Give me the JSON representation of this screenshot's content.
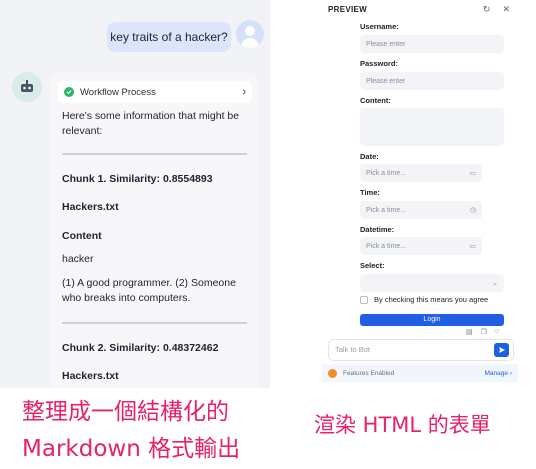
{
  "chat": {
    "user_message": "key traits of a hacker?",
    "workflow_label": "Workflow Process",
    "intro": "Here's some information that might be relevant:",
    "chunk1_title": "Chunk 1. Similarity: 0.8554893",
    "chunk1_file": "Hackers.txt",
    "content_heading": "Content",
    "content_word": "hacker",
    "content_text": "(1) A good programmer. (2) Someone who breaks into computers.",
    "chunk2_title": "Chunk 2. Similarity: 0.48372462",
    "chunk2_file": "Hackers.txt"
  },
  "preview": {
    "title": "PREVIEW",
    "username_label": "Username:",
    "username_placeholder": "Please enter",
    "password_label": "Password:",
    "password_placeholder": "Please enter",
    "content_label": "Content:",
    "date_label": "Date:",
    "date_placeholder": "Pick a time...",
    "time_label": "Time:",
    "time_placeholder": "Pick a time...",
    "datetime_label": "Datetime:",
    "datetime_placeholder": "Pick a time...",
    "select_label": "Select:",
    "checkbox_label": "By checking this means you agree",
    "login_button": "Login",
    "talk_placeholder": "Talk to Bot",
    "features_label": "Features Enabled",
    "manage_label": "Manage"
  },
  "captions": {
    "left_line1": "整理成一個結構化的",
    "left_line2": "Markdown 格式輸出",
    "right": "渲染 HTML 的表單"
  },
  "colors": {
    "caption": "#e5226a",
    "accent_blue": "#1f5fe6",
    "success_green": "#2fb566"
  }
}
